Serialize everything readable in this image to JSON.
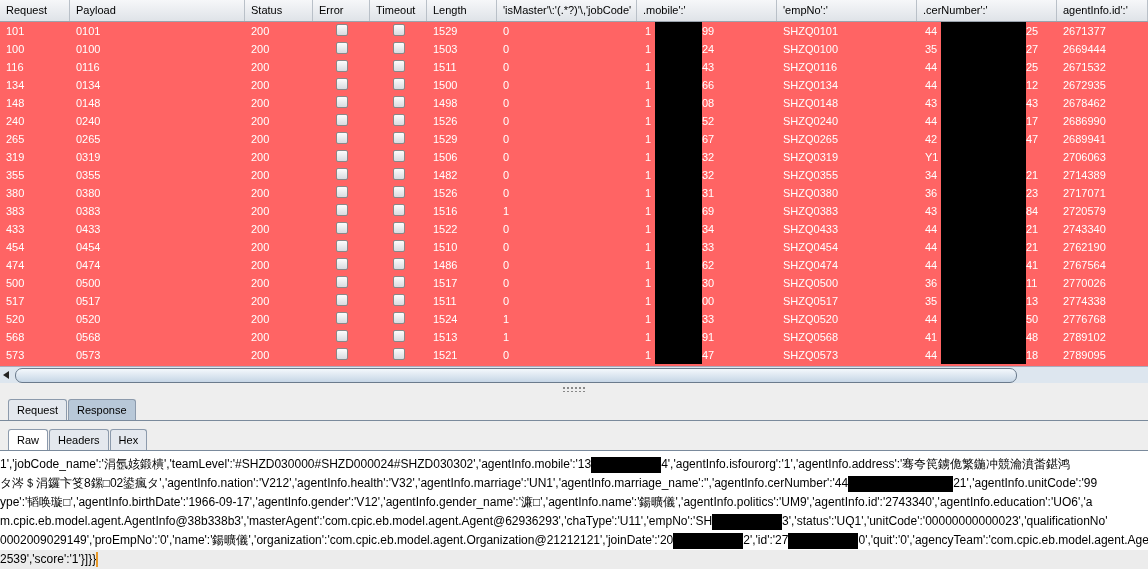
{
  "results_table": {
    "columns": [
      "Request",
      "Payload",
      "Status",
      "Error",
      "Timeout",
      "Length",
      "'isMaster'\\:'(.*?)'\\,'jobCode'",
      ".mobile':'",
      "'empNo':'",
      ".cerNumber':'",
      "agentInfo.id':'"
    ],
    "rows": [
      {
        "request": "101",
        "payload": "0101",
        "status": "200",
        "error": false,
        "timeout": false,
        "length": "1529",
        "is_master": "0",
        "mobile": {
          "start": "1",
          "end": "99"
        },
        "emp_no": "SHZQ0101",
        "cer_number": {
          "start": "44",
          "end": "25"
        },
        "agent_id": "2671377"
      },
      {
        "request": "100",
        "payload": "0100",
        "status": "200",
        "error": false,
        "timeout": false,
        "length": "1503",
        "is_master": "0",
        "mobile": {
          "start": "1",
          "end": "24"
        },
        "emp_no": "SHZQ0100",
        "cer_number": {
          "start": "35",
          "end": "27"
        },
        "agent_id": "2669444"
      },
      {
        "request": "116",
        "payload": "0116",
        "status": "200",
        "error": false,
        "timeout": false,
        "length": "1511",
        "is_master": "0",
        "mobile": {
          "start": "1",
          "end": "43"
        },
        "emp_no": "SHZQ0116",
        "cer_number": {
          "start": "44",
          "end": "25"
        },
        "agent_id": "2671532"
      },
      {
        "request": "134",
        "payload": "0134",
        "status": "200",
        "error": false,
        "timeout": false,
        "length": "1500",
        "is_master": "0",
        "mobile": {
          "start": "1",
          "end": "66"
        },
        "emp_no": "SHZQ0134",
        "cer_number": {
          "start": "44",
          "end": "12"
        },
        "agent_id": "2672935"
      },
      {
        "request": "148",
        "payload": "0148",
        "status": "200",
        "error": false,
        "timeout": false,
        "length": "1498",
        "is_master": "0",
        "mobile": {
          "start": "1",
          "end": "08"
        },
        "emp_no": "SHZQ0148",
        "cer_number": {
          "start": "43",
          "end": "43"
        },
        "agent_id": "2678462"
      },
      {
        "request": "240",
        "payload": "0240",
        "status": "200",
        "error": false,
        "timeout": false,
        "length": "1526",
        "is_master": "0",
        "mobile": {
          "start": "1",
          "end": "52"
        },
        "emp_no": "SHZQ0240",
        "cer_number": {
          "start": "44",
          "end": "17"
        },
        "agent_id": "2686990"
      },
      {
        "request": "265",
        "payload": "0265",
        "status": "200",
        "error": false,
        "timeout": false,
        "length": "1529",
        "is_master": "0",
        "mobile": {
          "start": "1",
          "end": "67"
        },
        "emp_no": "SHZQ0265",
        "cer_number": {
          "start": "42",
          "end": "47"
        },
        "agent_id": "2689941"
      },
      {
        "request": "319",
        "payload": "0319",
        "status": "200",
        "error": false,
        "timeout": false,
        "length": "1506",
        "is_master": "0",
        "mobile": {
          "start": "1",
          "end": "32"
        },
        "emp_no": "SHZQ0319",
        "cer_number": {
          "start": "Y1"
        },
        "agent_id": "2706063"
      },
      {
        "request": "355",
        "payload": "0355",
        "status": "200",
        "error": false,
        "timeout": false,
        "length": "1482",
        "is_master": "0",
        "mobile": {
          "start": "1",
          "end": "32"
        },
        "emp_no": "SHZQ0355",
        "cer_number": {
          "start": "34",
          "end": "21"
        },
        "agent_id": "2714389"
      },
      {
        "request": "380",
        "payload": "0380",
        "status": "200",
        "error": false,
        "timeout": false,
        "length": "1526",
        "is_master": "0",
        "mobile": {
          "start": "1",
          "end": "31"
        },
        "emp_no": "SHZQ0380",
        "cer_number": {
          "start": "36",
          "end": "23"
        },
        "agent_id": "2717071"
      },
      {
        "request": "383",
        "payload": "0383",
        "status": "200",
        "error": false,
        "timeout": false,
        "length": "1516",
        "is_master": "1",
        "mobile": {
          "start": "1",
          "end": "69"
        },
        "emp_no": "SHZQ0383",
        "cer_number": {
          "start": "43",
          "end": "84"
        },
        "agent_id": "2720579"
      },
      {
        "request": "433",
        "payload": "0433",
        "status": "200",
        "error": false,
        "timeout": false,
        "length": "1522",
        "is_master": "0",
        "mobile": {
          "start": "1",
          "end": "34"
        },
        "emp_no": "SHZQ0433",
        "cer_number": {
          "start": "44",
          "end": "21"
        },
        "agent_id": "2743340"
      },
      {
        "request": "454",
        "payload": "0454",
        "status": "200",
        "error": false,
        "timeout": false,
        "length": "1510",
        "is_master": "0",
        "mobile": {
          "start": "1",
          "end": "33"
        },
        "emp_no": "SHZQ0454",
        "cer_number": {
          "start": "44",
          "end": "21"
        },
        "agent_id": "2762190"
      },
      {
        "request": "474",
        "payload": "0474",
        "status": "200",
        "error": false,
        "timeout": false,
        "length": "1486",
        "is_master": "0",
        "mobile": {
          "start": "1",
          "end": "62"
        },
        "emp_no": "SHZQ0474",
        "cer_number": {
          "start": "44",
          "end": "41"
        },
        "agent_id": "2767564"
      },
      {
        "request": "500",
        "payload": "0500",
        "status": "200",
        "error": false,
        "timeout": false,
        "length": "1517",
        "is_master": "0",
        "mobile": {
          "start": "1",
          "end": "30"
        },
        "emp_no": "SHZQ0500",
        "cer_number": {
          "start": "36",
          "end": "11"
        },
        "agent_id": "2770026"
      },
      {
        "request": "517",
        "payload": "0517",
        "status": "200",
        "error": false,
        "timeout": false,
        "length": "1511",
        "is_master": "0",
        "mobile": {
          "start": "1",
          "end": "00"
        },
        "emp_no": "SHZQ0517",
        "cer_number": {
          "start": "35",
          "end": "13"
        },
        "agent_id": "2774338"
      },
      {
        "request": "520",
        "payload": "0520",
        "status": "200",
        "error": false,
        "timeout": false,
        "length": "1524",
        "is_master": "1",
        "mobile": {
          "start": "1",
          "end": "33"
        },
        "emp_no": "SHZQ0520",
        "cer_number": {
          "start": "44",
          "end": "50"
        },
        "agent_id": "2776768"
      },
      {
        "request": "568",
        "payload": "0568",
        "status": "200",
        "error": false,
        "timeout": false,
        "length": "1513",
        "is_master": "1",
        "mobile": {
          "start": "1",
          "end": "91"
        },
        "emp_no": "SHZQ0568",
        "cer_number": {
          "start": "41",
          "end": "48"
        },
        "agent_id": "2789102"
      },
      {
        "request": "573",
        "payload": "0573",
        "status": "200",
        "error": false,
        "timeout": false,
        "length": "1521",
        "is_master": "0",
        "mobile": {
          "start": "1",
          "end": "47"
        },
        "emp_no": "SHZQ0573",
        "cer_number": {
          "start": "44",
          "end": "18"
        },
        "agent_id": "2789095"
      }
    ]
  },
  "message_tabs": [
    {
      "label": "Request",
      "selected": false
    },
    {
      "label": "Response",
      "selected": true
    }
  ],
  "view_tabs": [
    {
      "label": "Raw",
      "selected": true
    },
    {
      "label": "Headers",
      "selected": false
    },
    {
      "label": "Hex",
      "selected": false
    }
  ],
  "response_lines": [
    {
      "current": false,
      "segments": [
        {
          "kind": "text",
          "text": "1','jobCode_name':'涓氬姟鍛樻','teamLevel':'#SHZD030000#SHZD000024#SHZD030302','agentInfo.mobile':'13"
        },
        {
          "kind": "redaction"
        },
        {
          "kind": "text",
          "text": "4','agentInfo.isfourorg':'1','agentInfo.address':'骞夸笢鐪佹繁鍦冲競瀹濆畨鍖鸿"
        }
      ]
    },
    {
      "current": false,
      "segments": [
        {
          "kind": "text",
          "text": "タ涔＄涓鑼卞笅8鏍□02鍙瘋タ','agentInfo.nation':'V212','agentInfo.health':'V32','agentInfo.marriage':'UN1','agentInfo.marriage_name':'','agentInfo.cerNumber':'44"
        },
        {
          "kind": "wideredaction"
        },
        {
          "kind": "text",
          "text": "21','agentInfo.unitCode':'99"
        }
      ]
    },
    {
      "current": false,
      "segments": [
        {
          "kind": "text",
          "text": "ype':'韬唤璇□','agentInfo.birthDate':'1966-09-17','agentInfo.gender':'V12','agentInfo.gender_name':'濂□','agentInfo.name':'鍚曠儀','agentInfo.politics':'UM9','agentInfo.id':'2743340','agentInfo.education':'UO6','a"
        }
      ]
    },
    {
      "current": false,
      "segments": [
        {
          "kind": "text",
          "text": "m.cpic.eb.model.agent.AgentInfo@38b338b3','masterAgent':'com.cpic.eb.model.agent.Agent@62936293','chaType':'U11','empNo':'SH"
        },
        {
          "kind": "redaction"
        },
        {
          "kind": "text",
          "text": "3','status':'UQ1','unitCode':'00000000000023','qualificationNo'"
        }
      ]
    },
    {
      "current": false,
      "segments": [
        {
          "kind": "text",
          "text": "0002009029149','proEmpNo':'0','name':'鍚曠儀','organization':'com.cpic.eb.model.agent.Organization@21212121','joinDate':'20"
        },
        {
          "kind": "redaction"
        },
        {
          "kind": "text",
          "text": "2','id':'27"
        },
        {
          "kind": "redaction"
        },
        {
          "kind": "text",
          "text": "0','quit':'0','agencyTeam':'com.cpic.eb.model.agent.Age"
        }
      ]
    },
    {
      "current": true,
      "segments": [
        {
          "kind": "text",
          "text": "2539','score':'1'}]}}"
        }
      ]
    }
  ]
}
